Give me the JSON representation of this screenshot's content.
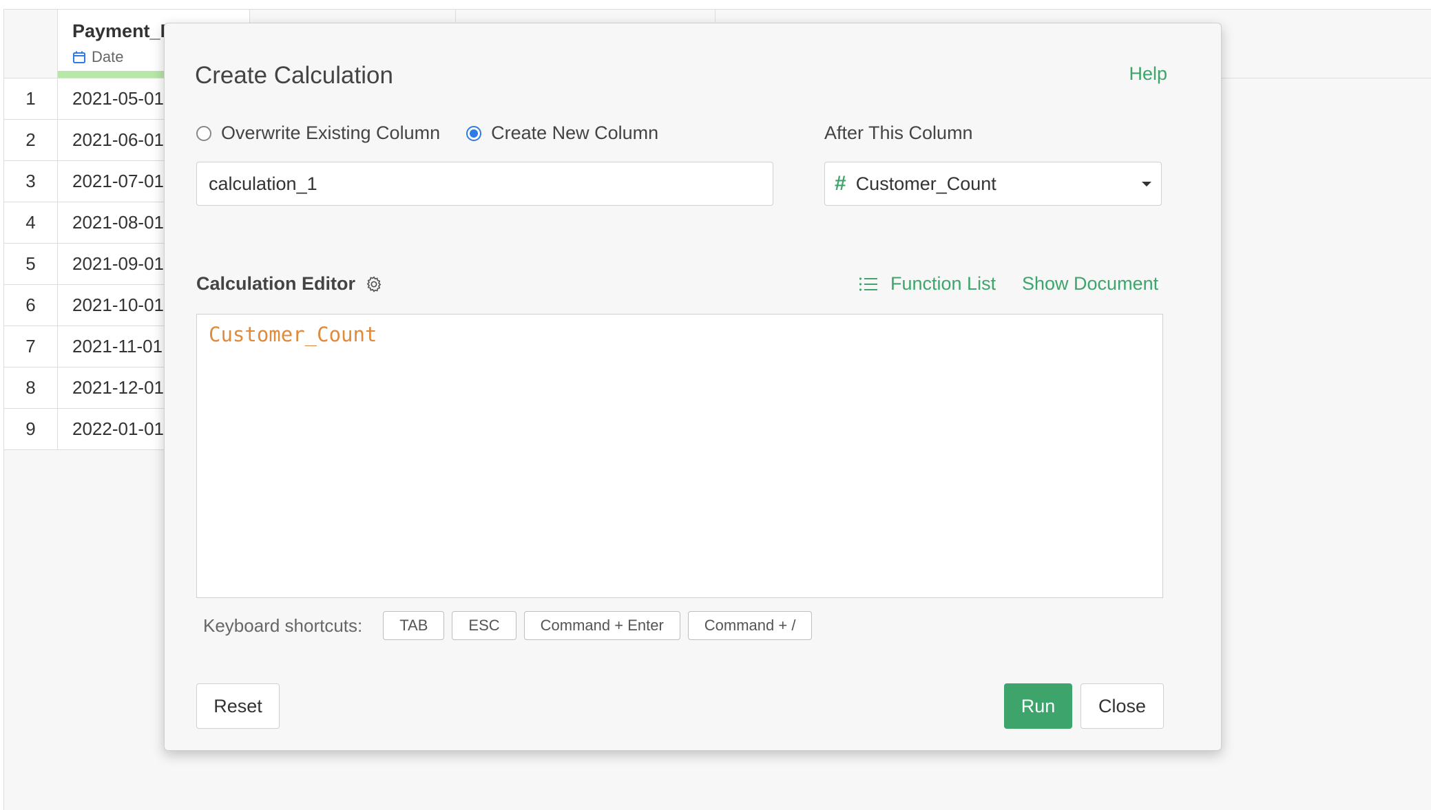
{
  "sheet": {
    "column": {
      "name": "Payment_Date",
      "type": "Date"
    },
    "rows": [
      {
        "num": "1",
        "value": "2021-05-01"
      },
      {
        "num": "2",
        "value": "2021-06-01"
      },
      {
        "num": "3",
        "value": "2021-07-01"
      },
      {
        "num": "4",
        "value": "2021-08-01"
      },
      {
        "num": "5",
        "value": "2021-09-01"
      },
      {
        "num": "6",
        "value": "2021-10-01"
      },
      {
        "num": "7",
        "value": "2021-11-01"
      },
      {
        "num": "8",
        "value": "2021-12-01"
      },
      {
        "num": "9",
        "value": "2022-01-01"
      }
    ]
  },
  "dialog": {
    "title": "Create Calculation",
    "help_label": "Help",
    "options": {
      "overwrite_label": "Overwrite Existing Column",
      "create_label": "Create New Column",
      "selected": "create"
    },
    "new_column_name": "calculation_1",
    "after_column": {
      "label": "After This Column",
      "selected": "Customer_Count"
    },
    "editor": {
      "label": "Calculation Editor",
      "function_list_label": "Function List",
      "show_document_label": "Show Document",
      "code": "Customer_Count"
    },
    "shortcuts": {
      "label": "Keyboard shortcuts:",
      "keys": [
        "TAB",
        "ESC",
        "Command + Enter",
        "Command + /"
      ]
    },
    "buttons": {
      "reset": "Reset",
      "run": "Run",
      "close": "Close"
    }
  },
  "colors": {
    "accent": "#3da56b",
    "radio_selected": "#2d7be5",
    "code_column": "#e08a3c",
    "date_bar": "#b7e8a7"
  }
}
